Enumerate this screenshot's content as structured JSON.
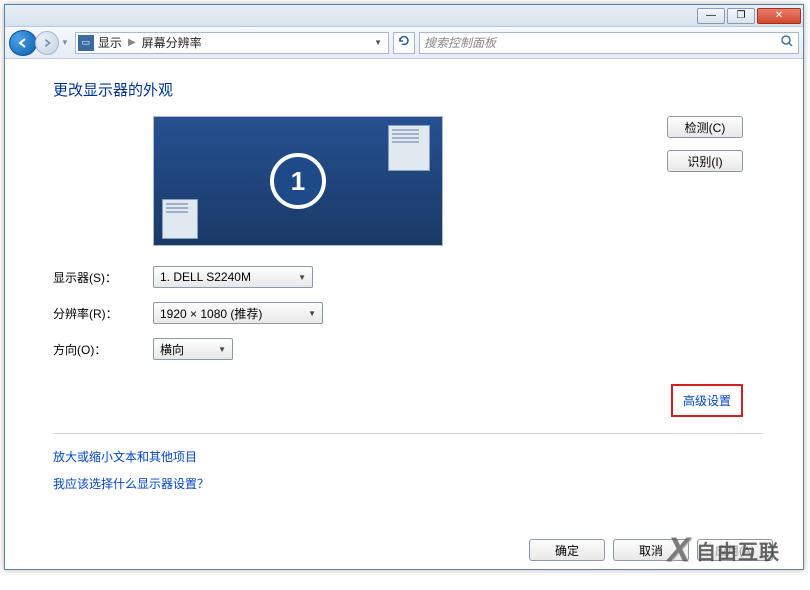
{
  "titlebar": {
    "minimize_glyph": "—",
    "maximize_glyph": "❐",
    "close_glyph": "✕"
  },
  "nav": {
    "breadcrumb": {
      "item1": "显示",
      "item2": "屏幕分辨率"
    },
    "search_placeholder": "搜索控制面板"
  },
  "content": {
    "heading": "更改显示器的外观",
    "monitor_number": "1",
    "detect_btn": "检测(C)",
    "identify_btn": "识别(I)",
    "labels": {
      "display": "显示器(S)：",
      "resolution": "分辨率(R)：",
      "orientation": "方向(O)："
    },
    "values": {
      "display": "1. DELL S2240M",
      "resolution": "1920 × 1080 (推荐)",
      "orientation": "横向"
    },
    "advanced_link": "高级设置",
    "help1": "放大或缩小文本和其他项目",
    "help2": "我应该选择什么显示器设置？"
  },
  "footer": {
    "ok": "确定",
    "cancel": "取消",
    "apply": "应用(A)"
  },
  "watermark": {
    "text": "自由互联"
  }
}
